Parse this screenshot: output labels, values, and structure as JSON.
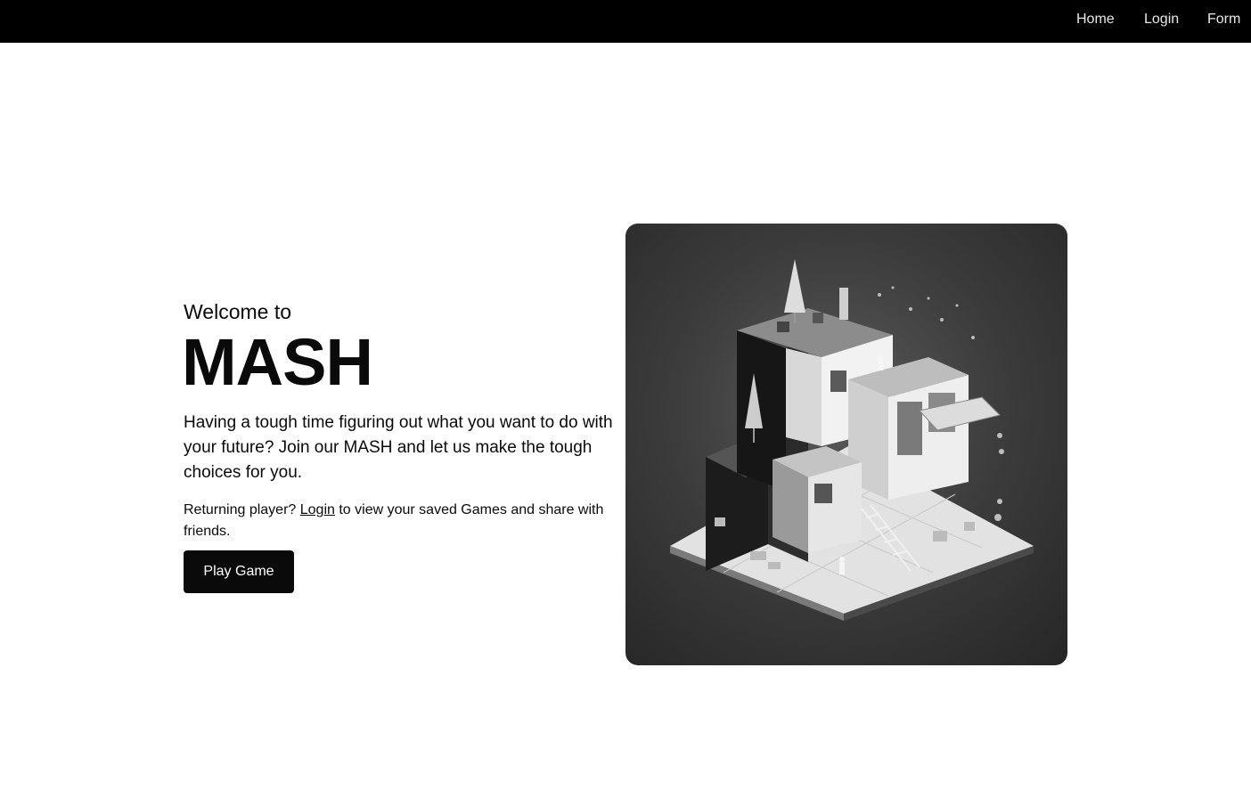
{
  "nav": {
    "links": [
      "Home",
      "Login",
      "Form"
    ]
  },
  "hero": {
    "welcome": "Welcome to",
    "title": "MASH",
    "lead": "Having a tough time figuring out what you want to do with your future? Join our MASH and let us make the tough choices for you.",
    "returning_prefix": "Returning player? ",
    "returning_link": "Login",
    "returning_suffix": " to view your saved Games and share with friends.",
    "play_button": "Play Game"
  },
  "image": {
    "alt": "isometric-house-illustration"
  },
  "colors": {
    "navbar_bg": "#000000",
    "button_bg": "#0a0a0a",
    "text": "#0a0a0a"
  }
}
